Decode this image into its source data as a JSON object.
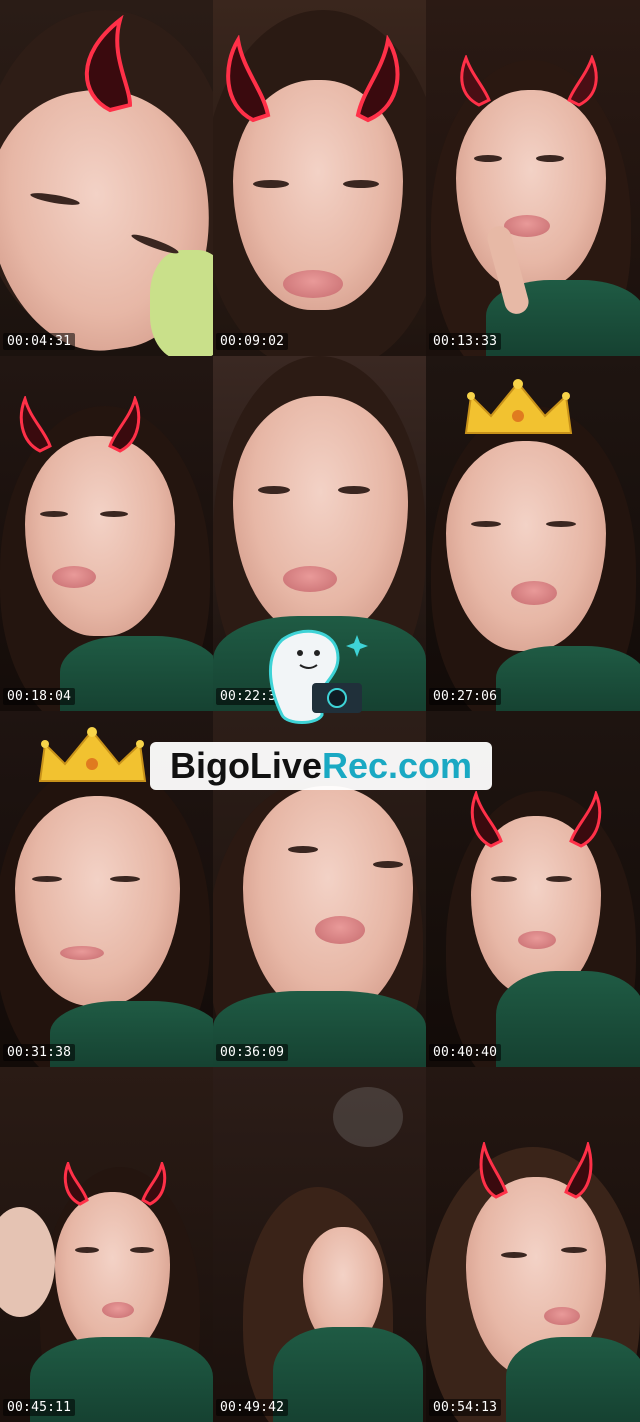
{
  "watermark": {
    "part1": "BigoLive",
    "part2": "Rec.com"
  },
  "frames": [
    {
      "timestamp": "00:04:31",
      "overlay": "devil-horns"
    },
    {
      "timestamp": "00:09:02",
      "overlay": "devil-horns"
    },
    {
      "timestamp": "00:13:33",
      "overlay": "devil-horns"
    },
    {
      "timestamp": "00:18:04",
      "overlay": "devil-horns"
    },
    {
      "timestamp": "00:22:35",
      "overlay": "none"
    },
    {
      "timestamp": "00:27:06",
      "overlay": "crown"
    },
    {
      "timestamp": "00:31:38",
      "overlay": "crown"
    },
    {
      "timestamp": "00:36:09",
      "overlay": "none"
    },
    {
      "timestamp": "00:40:40",
      "overlay": "devil-horns"
    },
    {
      "timestamp": "00:45:11",
      "overlay": "devil-horns"
    },
    {
      "timestamp": "00:49:42",
      "overlay": "none"
    },
    {
      "timestamp": "00:54:13",
      "overlay": "devil-horns"
    }
  ],
  "colors": {
    "horn": "#e0243a",
    "crown": "#f2c230",
    "watermark_accent": "#1aa9c3"
  }
}
